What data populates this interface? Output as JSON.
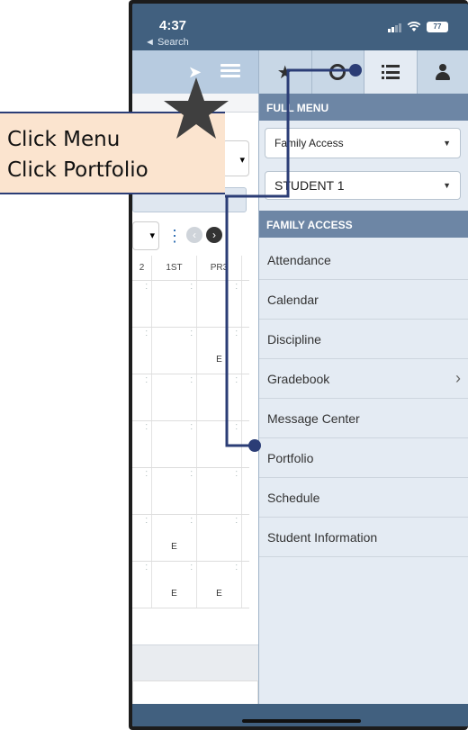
{
  "status_bar": {
    "time": "4:37",
    "back_label": "◄ Search",
    "battery": "77"
  },
  "menu": {
    "tabs": [
      "favorites",
      "recent",
      "full-menu",
      "account"
    ],
    "full_menu_header": "FULL MENU",
    "module_select": {
      "value": "Family Access"
    },
    "student_select": {
      "value": "STUDENT 1"
    },
    "family_access_header": "FAMILY ACCESS",
    "items": [
      {
        "label": "Attendance",
        "has_submenu": false
      },
      {
        "label": "Calendar",
        "has_submenu": false
      },
      {
        "label": "Discipline",
        "has_submenu": false
      },
      {
        "label": "Gradebook",
        "has_submenu": true
      },
      {
        "label": "Message Center",
        "has_submenu": false
      },
      {
        "label": "Portfolio",
        "has_submenu": false
      },
      {
        "label": "Schedule",
        "has_submenu": false
      },
      {
        "label": "Student Information",
        "has_submenu": false
      }
    ]
  },
  "background_table": {
    "headers": [
      "2",
      "1ST",
      "PR3"
    ],
    "rows": [
      [
        "",
        "",
        ""
      ],
      [
        "",
        "",
        "E"
      ],
      [
        "",
        "",
        ""
      ],
      [
        "",
        "",
        ""
      ],
      [
        "",
        "",
        ""
      ],
      [
        "",
        "E",
        ""
      ],
      [
        "",
        "E",
        "E"
      ]
    ]
  },
  "callout": {
    "line1": "Click Menu",
    "line2": "Click Portfolio"
  },
  "colors": {
    "annotation_line": "#2b3d76",
    "callout_bg": "#fbe4cf",
    "section_header": "#6d86a5",
    "status_bar": "#41607f"
  }
}
